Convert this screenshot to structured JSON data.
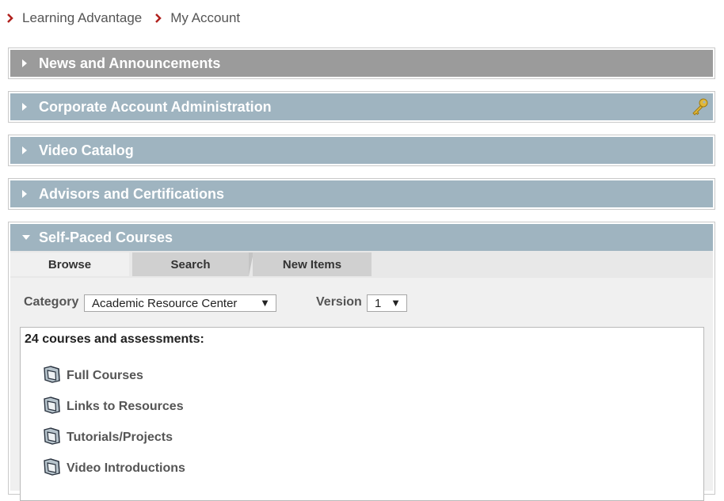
{
  "breadcrumb": [
    {
      "label": "Learning Advantage"
    },
    {
      "label": "My Account"
    }
  ],
  "panels": {
    "news": {
      "title": "News and Announcements"
    },
    "corporate": {
      "title": "Corporate Account Administration"
    },
    "video": {
      "title": "Video Catalog"
    },
    "advisors": {
      "title": "Advisors and Certifications"
    },
    "selfpaced": {
      "title": "Self-Paced Courses"
    }
  },
  "tabs": [
    {
      "label": "Browse",
      "active": true
    },
    {
      "label": "Search",
      "active": false
    },
    {
      "label": "New Items",
      "active": false
    }
  ],
  "filters": {
    "category_label": "Category",
    "category_value": "Academic Resource Center",
    "version_label": "Version",
    "version_value": "1"
  },
  "list": {
    "count_text": "24 courses and assessments:",
    "items": [
      {
        "label": "Full Courses"
      },
      {
        "label": "Links to Resources"
      },
      {
        "label": "Tutorials/Projects"
      },
      {
        "label": "Video Introductions"
      }
    ]
  },
  "colors": {
    "header_gray": "#9b9b9b",
    "header_blue": "#9fb4c0",
    "breadcrumb_chevron": "#b0201d",
    "key_icon": "#e1b83a"
  },
  "icons": [
    "chevron-right-icon",
    "triangle-right-icon",
    "triangle-down-icon",
    "key-icon",
    "folder-icon",
    "dropdown-caret-icon"
  ]
}
